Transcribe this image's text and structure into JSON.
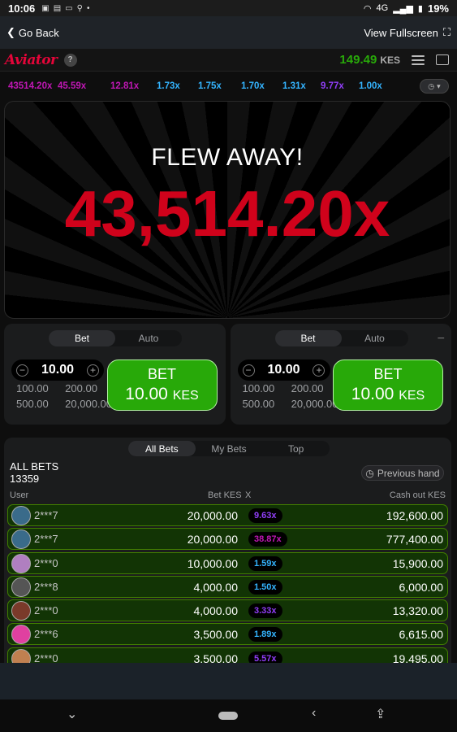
{
  "status_bar": {
    "time": "10:06",
    "network": "4G",
    "battery": "19%"
  },
  "nav": {
    "back_label": "Go Back",
    "fullscreen_label": "View Fullscreen"
  },
  "header": {
    "logo": "Aviator",
    "help": "?",
    "balance": "149.49",
    "currency": "KES"
  },
  "history": [
    "43514.20x",
    "45.59x",
    "12.81x",
    "1.73x",
    "1.75x",
    "1.70x",
    "1.31x",
    "9.77x",
    "1.00x"
  ],
  "history_colors": [
    "#c017b4",
    "#c017b4",
    "#c017b4",
    "#34b4ff",
    "#34b4ff",
    "#34b4ff",
    "#34b4ff",
    "#913ef8",
    "#34b4ff"
  ],
  "game": {
    "status": "FLEW AWAY!",
    "multiplier": "43,514.20x"
  },
  "bet_panels": [
    {
      "tab_bet": "Bet",
      "tab_auto": "Auto",
      "amount": "10.00",
      "quick": [
        "100.00",
        "200.00",
        "500.00",
        "20,000.00"
      ],
      "button_title": "BET",
      "button_amount": "10.00",
      "button_currency": "KES"
    },
    {
      "tab_bet": "Bet",
      "tab_auto": "Auto",
      "amount": "10.00",
      "quick": [
        "100.00",
        "200.00",
        "500.00",
        "20,000.00"
      ],
      "button_title": "BET",
      "button_amount": "10.00",
      "button_currency": "KES"
    }
  ],
  "bets": {
    "tabs": [
      "All Bets",
      "My Bets",
      "Top"
    ],
    "title": "ALL BETS",
    "count": "13359",
    "previous_hand": "Previous hand",
    "columns": {
      "user": "User",
      "bet": "Bet KES",
      "x": "X",
      "cashout": "Cash out KES"
    },
    "rows": [
      {
        "user": "2***7",
        "bet": "20,000.00",
        "x": "9.63x",
        "x_color": "#913ef8",
        "cashout": "192,600.00"
      },
      {
        "user": "2***7",
        "bet": "20,000.00",
        "x": "38.87x",
        "x_color": "#c017b4",
        "cashout": "777,400.00"
      },
      {
        "user": "2***0",
        "bet": "10,000.00",
        "x": "1.59x",
        "x_color": "#34b4ff",
        "cashout": "15,900.00"
      },
      {
        "user": "2***8",
        "bet": "4,000.00",
        "x": "1.50x",
        "x_color": "#34b4ff",
        "cashout": "6,000.00"
      },
      {
        "user": "2***0",
        "bet": "4,000.00",
        "x": "3.33x",
        "x_color": "#913ef8",
        "cashout": "13,320.00"
      },
      {
        "user": "2***6",
        "bet": "3,500.00",
        "x": "1.89x",
        "x_color": "#34b4ff",
        "cashout": "6,615.00"
      },
      {
        "user": "2***0",
        "bet": "3,500.00",
        "x": "5.57x",
        "x_color": "#913ef8",
        "cashout": "19,495.00"
      }
    ]
  }
}
